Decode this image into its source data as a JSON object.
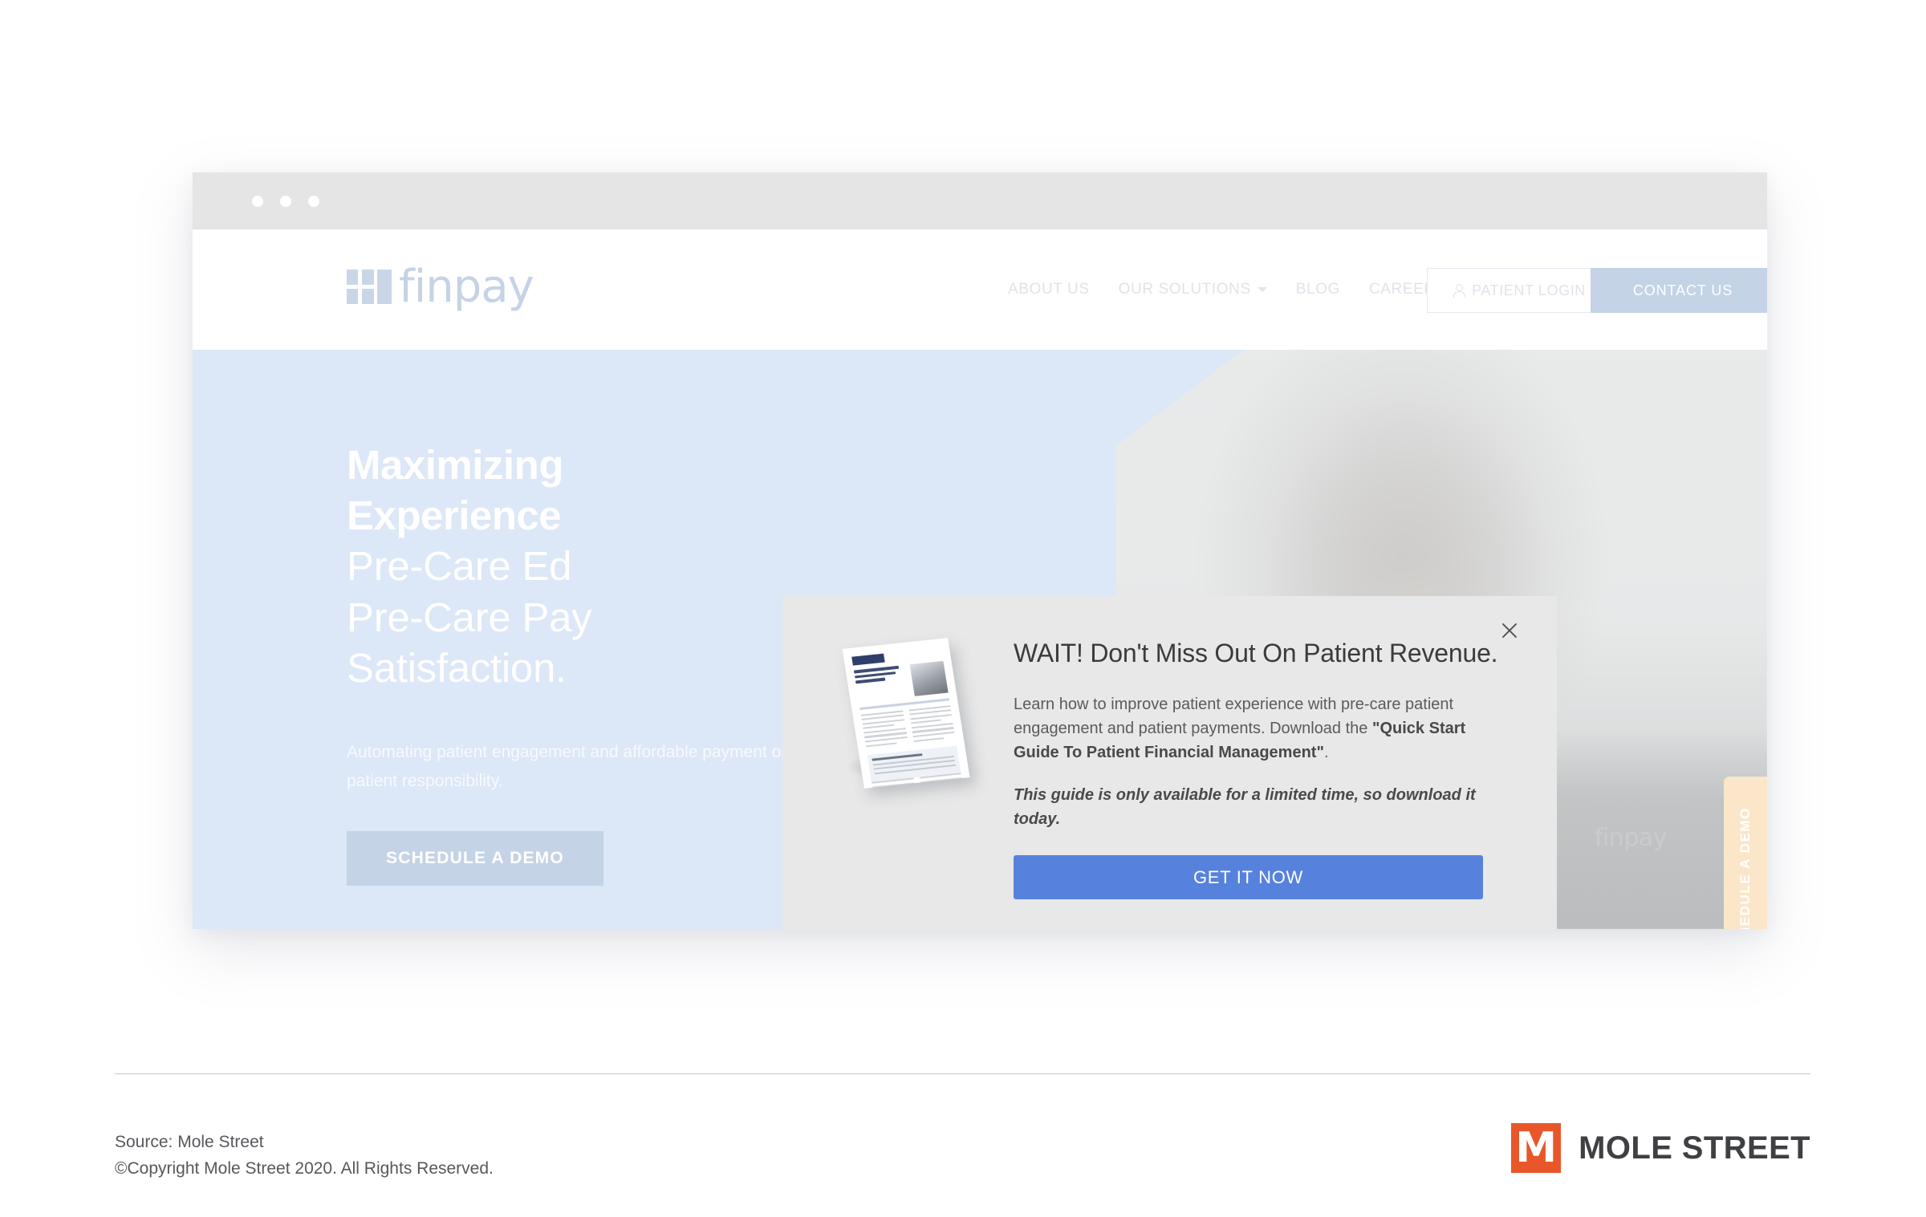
{
  "browser": {
    "dots_count": 3
  },
  "site": {
    "logo_text": "finpay",
    "nav": [
      {
        "label": "ABOUT US",
        "has_dropdown": false
      },
      {
        "label": "OUR SOLUTIONS",
        "has_dropdown": true
      },
      {
        "label": "BLOG",
        "has_dropdown": false
      },
      {
        "label": "CAREERS",
        "has_dropdown": false
      }
    ],
    "login_button": "PATIENT LOGIN",
    "contact_button": "CONTACT US"
  },
  "hero": {
    "heading_bold_1": "Maximizing",
    "heading_bold_2": "Experience",
    "heading_light_1": "Pre-Care Ed",
    "heading_light_2": "Pre-Care Pay",
    "heading_light_3": "Satisfaction.",
    "subtext": "Automating patient engagement and affordable payment options patient responsibility.",
    "cta": "SCHEDULE A DEMO",
    "photo_badge": "finpay"
  },
  "side_tab": {
    "label": "+ SCHEDULE A DEMO"
  },
  "modal": {
    "close_icon": "close-icon",
    "title": "WAIT! Don't Miss Out On Patient Revenue.",
    "paragraph_lead": "Learn how to improve patient experience with pre-care patient engagement and patient payments. Download the ",
    "paragraph_bold": "\"Quick Start Guide To Patient Financial Management\"",
    "paragraph_tail": ".",
    "urgency": "This guide is only available for a limited time, so download it today.",
    "cta": "GET IT NOW"
  },
  "footer": {
    "source": "Source: Mole Street",
    "copyright": "©Copyright Mole Street 2020. All Rights Reserved.",
    "brand_mark": "M",
    "brand_name": "MOLE STREET"
  },
  "colors": {
    "hero_bg": "#dce7f7",
    "modal_bg": "#e8e8e8",
    "cta_blue": "#5681dd",
    "contact_blue": "#c4d3e6",
    "side_tab_cream": "#fbe6c9",
    "brand_orange": "#e8572a",
    "logo_blue": "#c6d3e6"
  }
}
